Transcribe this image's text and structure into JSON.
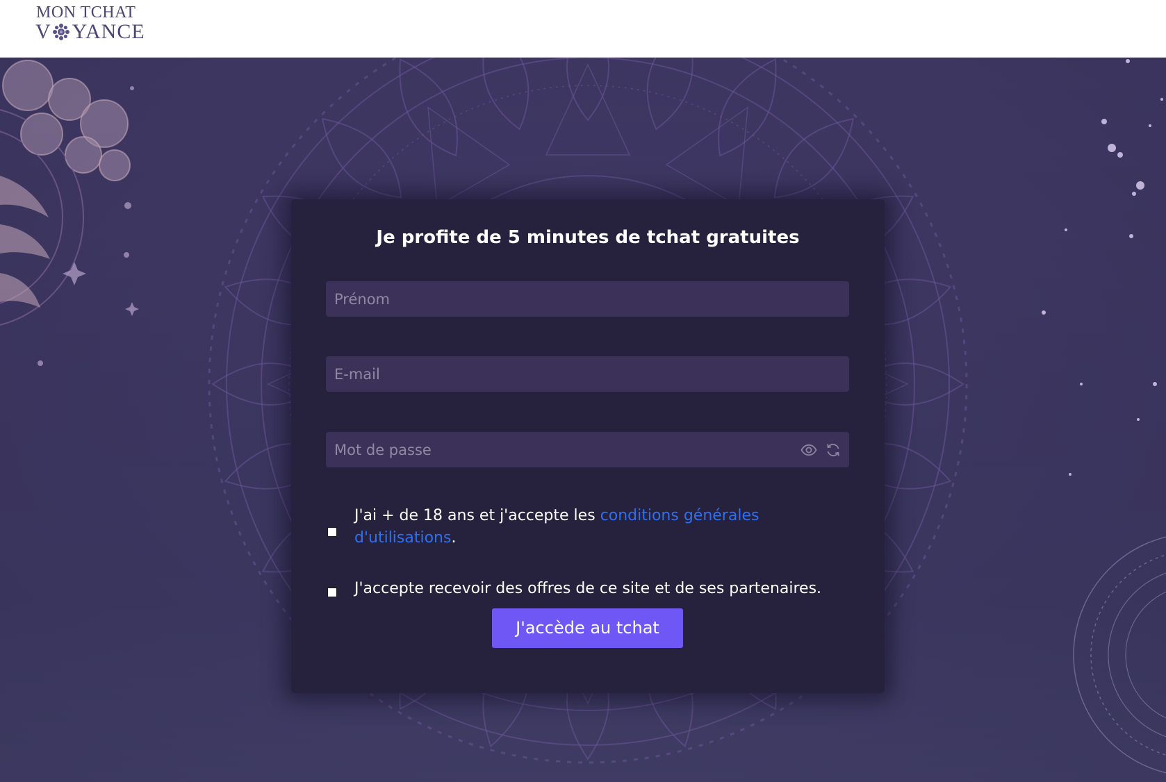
{
  "brand": {
    "logo_line1": "MON TCHAT",
    "logo_line2_start": "V",
    "logo_line2_end": "YANCE",
    "logo_color": "#4e4577"
  },
  "form": {
    "title": "Je profite de 5 minutes de tchat gratuites",
    "firstname": {
      "placeholder": "Prénom",
      "value": ""
    },
    "email": {
      "placeholder": "E-mail",
      "value": ""
    },
    "password": {
      "placeholder": "Mot de passe",
      "value": ""
    },
    "password_icons": [
      "eye-icon",
      "refresh-icon"
    ],
    "terms": {
      "checked": false,
      "text_before": "J'ai + de 18 ans et j'accepte les ",
      "link_text": "conditions générales d'utilisations",
      "text_after": "."
    },
    "offers": {
      "checked": false,
      "text": "J'accepte recevoir des offres de ce site et de ses partenaires."
    },
    "submit_label": "J'accède au tchat"
  },
  "colors": {
    "background": "#3d3762",
    "card": "#26213c",
    "input": "#3c3158",
    "accent": "#6e57f4",
    "link": "#2f6ff0"
  }
}
